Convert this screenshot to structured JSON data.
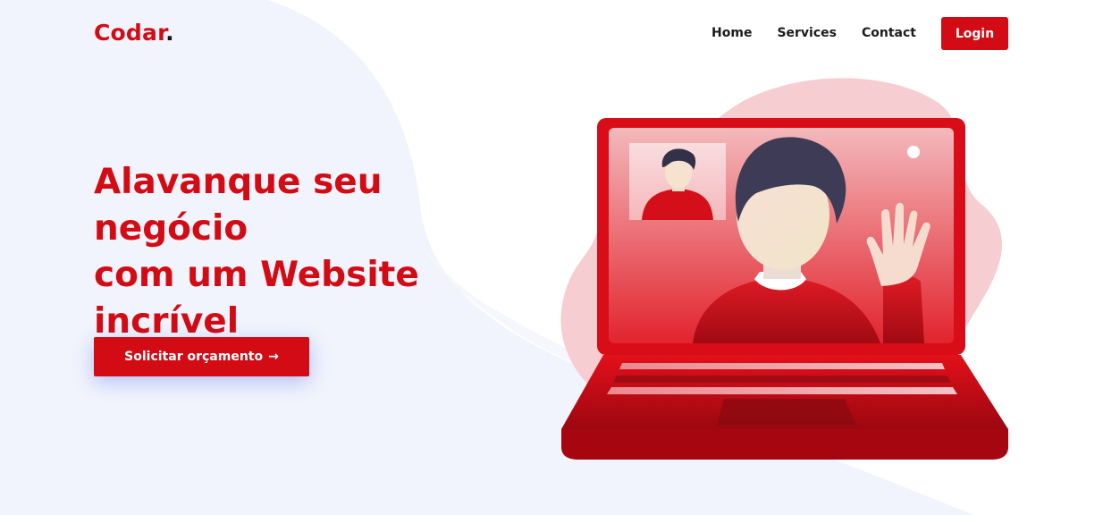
{
  "brand": {
    "name": "Codar",
    "dot": ".",
    "accent_color": "#d30b14"
  },
  "nav": {
    "items": [
      {
        "label": "Home"
      },
      {
        "label": "Services"
      },
      {
        "label": "Contact"
      }
    ],
    "login_label": "Login"
  },
  "hero": {
    "title_lines": [
      "Alavanque seu negócio",
      "com um Website",
      "incrível"
    ],
    "cta_label": "Solicitar orçamento",
    "cta_arrow": "→"
  },
  "illustration": {
    "icon": "video-call-laptop-illustration"
  }
}
